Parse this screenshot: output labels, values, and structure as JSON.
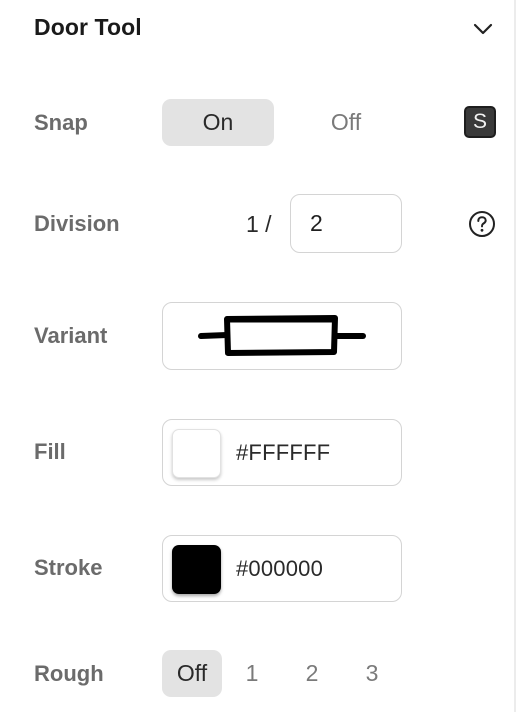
{
  "header": {
    "title": "Door Tool"
  },
  "snap": {
    "label": "Snap",
    "options": [
      "On",
      "Off"
    ],
    "selected": "On",
    "shortcut": "S"
  },
  "division": {
    "label": "Division",
    "prefix": "1 /",
    "value": "2"
  },
  "variant": {
    "label": "Variant"
  },
  "fill": {
    "label": "Fill",
    "hex": "#FFFFFF",
    "color": "#FFFFFF"
  },
  "stroke": {
    "label": "Stroke",
    "hex": "#000000",
    "color": "#000000"
  },
  "rough": {
    "label": "Rough",
    "options": [
      "Off",
      "1",
      "2",
      "3"
    ],
    "selected": "Off"
  },
  "colors": {
    "selected_segment_bg": "#E3E3E3",
    "label_gray": "#6B6B6B",
    "border": "#D4D4D4"
  },
  "icons": {
    "collapse": "chevron-down-icon",
    "help": "question-circle-icon",
    "variant_preview": "door-variant-icon"
  }
}
